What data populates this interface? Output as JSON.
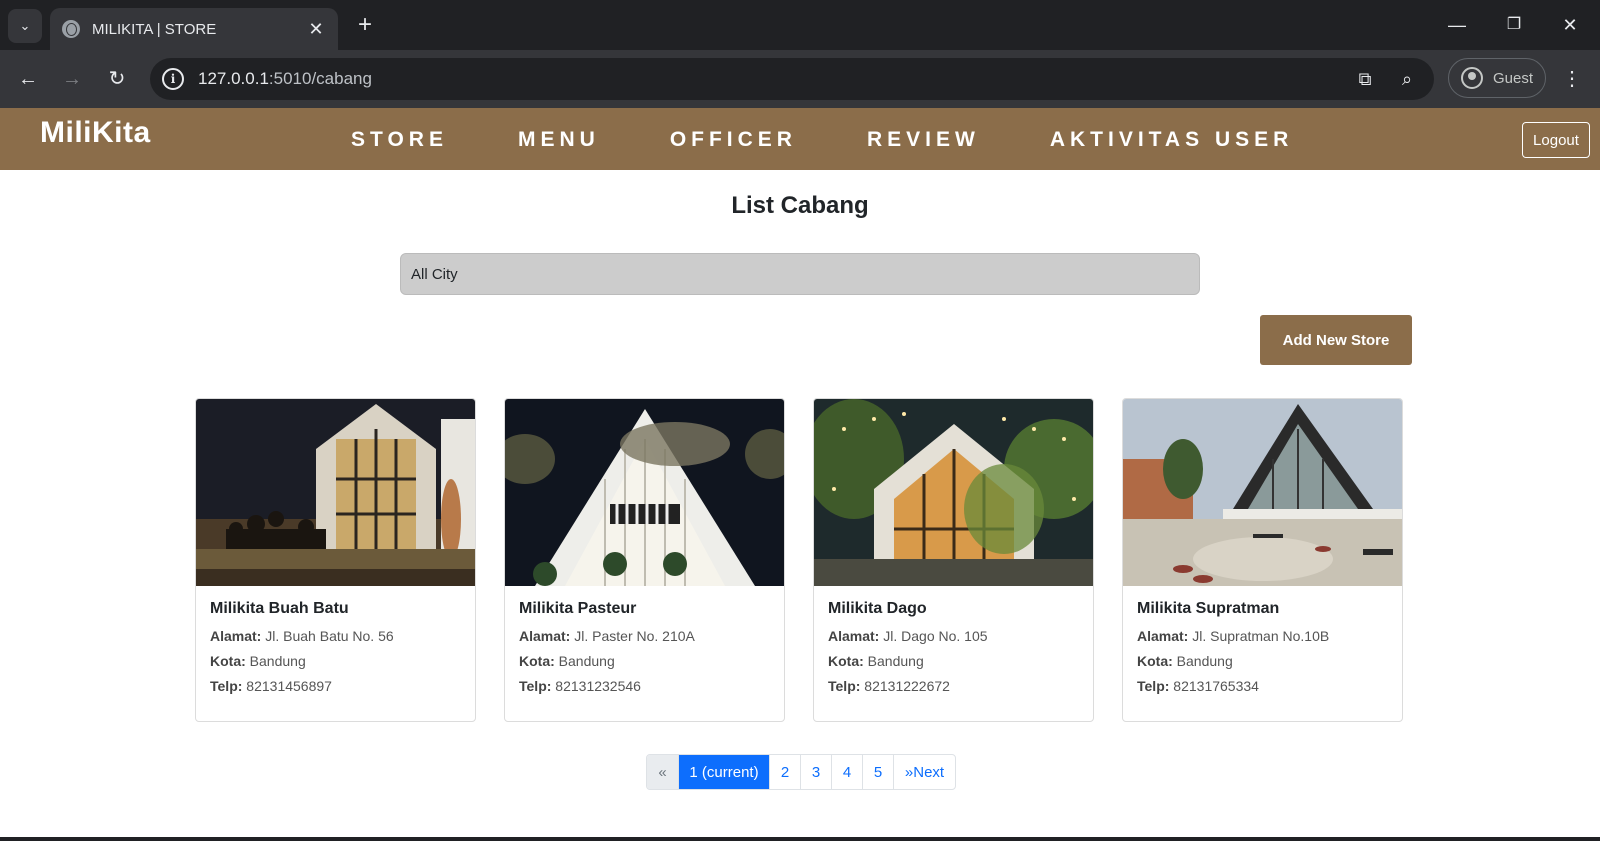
{
  "browser": {
    "tab_title": "MILIKITA | STORE",
    "url_host": "127.0.0.1",
    "url_path": ":5010/cabang",
    "profile_label": "Guest",
    "icons": {
      "tab_search": "chevron-down-icon",
      "favicon": "globe-icon",
      "close_tab": "close-icon",
      "new_tab": "plus-icon",
      "back": "arrow-left-icon",
      "forward": "arrow-right-icon",
      "reload": "reload-icon",
      "site_info": "info-icon",
      "translate": "translate-icon",
      "zoom": "zoom-icon",
      "menu": "more-vert-icon"
    }
  },
  "navbar": {
    "brand": "MiliKita",
    "links": [
      "STORE",
      "MENU",
      "OFFICER",
      "REVIEW",
      "AKTIVITAS USER"
    ],
    "logout_label": "Logout",
    "color": "#8b6d4a"
  },
  "main": {
    "title": "List Cabang",
    "city_filter": "All City",
    "add_button": "Add New Store"
  },
  "stores": [
    {
      "name": "Milikita Buah Batu",
      "alamat_label": "Alamat:",
      "alamat": "Jl. Buah Batu No. 56",
      "kota_label": "Kota:",
      "kota": "Bandung",
      "telp_label": "Telp:",
      "telp": "82131456897"
    },
    {
      "name": "Milikita Pasteur",
      "alamat_label": "Alamat:",
      "alamat": "Jl. Paster No. 210A",
      "kota_label": "Kota:",
      "kota": "Bandung",
      "telp_label": "Telp:",
      "telp": "82131232546"
    },
    {
      "name": "Milikita Dago",
      "alamat_label": "Alamat:",
      "alamat": "Jl. Dago No. 105",
      "kota_label": "Kota:",
      "kota": "Bandung",
      "telp_label": "Telp:",
      "telp": "82131222672"
    },
    {
      "name": "Milikita Supratman",
      "alamat_label": "Alamat:",
      "alamat": "Jl. Supratman No.10B",
      "kota_label": "Kota:",
      "kota": "Bandung",
      "telp_label": "Telp:",
      "telp": "82131765334"
    }
  ],
  "pagination": {
    "prev": "«",
    "current": "1 (current)",
    "pages": [
      "2",
      "3",
      "4",
      "5"
    ],
    "next": "»Next"
  }
}
